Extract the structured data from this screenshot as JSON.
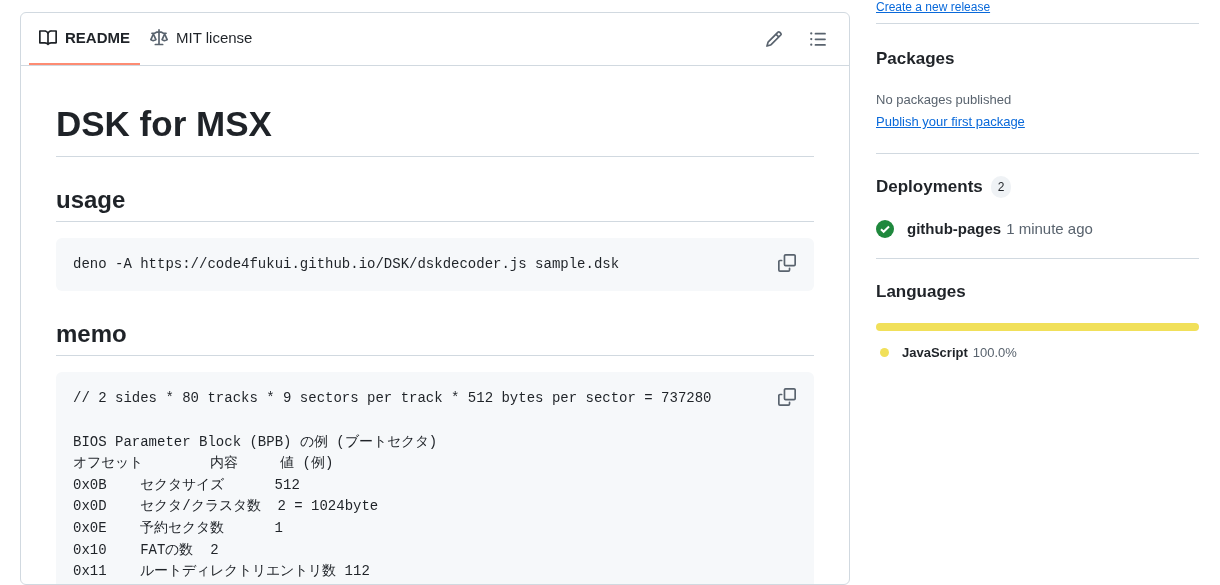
{
  "readme": {
    "tabs": [
      {
        "label": "README",
        "selected": true
      },
      {
        "label": "MIT license",
        "selected": false
      }
    ],
    "title": "DSK for MSX",
    "sections": [
      {
        "heading": "usage",
        "code": [
          "deno -A https://code4fukui.github.io/DSK/dskdecoder.js sample.dsk"
        ]
      },
      {
        "heading": "memo",
        "code": [
          "// 2 sides * 80 tracks * 9 sectors per track * 512 bytes per sector = 737280\n\nBIOS Parameter Block (BPB) の例 (ブートセクタ)",
          "オフセット        内容     値 (例)",
          "0x0B    セクタサイズ      512",
          "0x0D    セクタ/クラスタ数  2 = 1024byte",
          "0x0E    予約セクタ数      1",
          "0x10    FATの数  2",
          "0x11    ルートディレクトリエントリ数 112"
        ]
      }
    ]
  },
  "sidebar": {
    "top_link": "Create a new release",
    "packages": {
      "title": "Packages",
      "text": "No packages published",
      "link": "Publish your first package"
    },
    "deployments": {
      "title": "Deployments",
      "count": "2",
      "items": [
        {
          "name": "github-pages",
          "time": "1 minute ago",
          "succeeded": true
        }
      ]
    },
    "languages": {
      "title": "Languages",
      "items": [
        {
          "name": "JavaScript",
          "percent": "100.0%",
          "color": "#f1e05a",
          "level": 1.0
        }
      ]
    }
  }
}
